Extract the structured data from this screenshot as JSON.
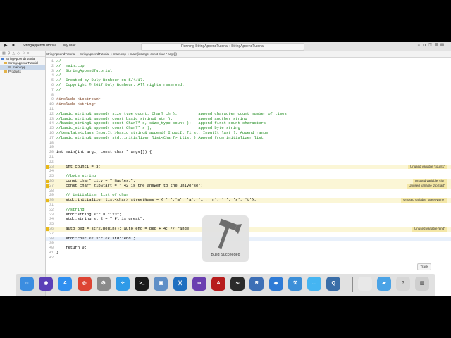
{
  "toolbar": {
    "scheme_app": "StringAppendTutorial",
    "scheme_device": "My Mac",
    "status": "Running StringAppendTutorial : StringAppendTutorial"
  },
  "jumpbar": {
    "items": [
      "StringAppendTutorial",
      "StringAppendTutorial",
      "main.cpp",
      "main(int argc, const char * argv[])"
    ]
  },
  "navigator": {
    "items": [
      {
        "label": "StringAppendTutorial",
        "color": "#4a7fd4"
      },
      {
        "label": "StringAppendTutorial",
        "color": "#e3b34a"
      },
      {
        "label": "main.cpp",
        "color": "#9aa0a6"
      },
      {
        "label": "Products",
        "color": "#e3b34a"
      }
    ]
  },
  "editor": {
    "lines": [
      {
        "n": "1",
        "text": "//",
        "cls": "c-com"
      },
      {
        "n": "2",
        "text": "//  main.cpp",
        "cls": "c-com"
      },
      {
        "n": "3",
        "text": "//  StringAppendTutorial",
        "cls": "c-com"
      },
      {
        "n": "4",
        "text": "//",
        "cls": "c-com"
      },
      {
        "n": "5",
        "text": "//  Created by Duly Bonheur on 5/4/17.",
        "cls": "c-com"
      },
      {
        "n": "6",
        "text": "//  Copyright © 2017 Duly Bonheur. All rights reserved.",
        "cls": "c-com"
      },
      {
        "n": "7",
        "text": "//",
        "cls": "c-com"
      },
      {
        "n": "8",
        "text": "",
        "cls": ""
      },
      {
        "n": "9",
        "text": "#include <iostream>",
        "cls": "c-pre"
      },
      {
        "n": "10",
        "text": "#include <string>",
        "cls": "c-pre"
      },
      {
        "n": "11",
        "text": "",
        "cls": ""
      },
      {
        "n": "12",
        "text": "//basic_string& append( size_type count, CharT ch );         append character count number of times",
        "cls": "c-com"
      },
      {
        "n": "13",
        "text": "//basic_string& append( const basic_string& str );           append another string",
        "cls": "c-com"
      },
      {
        "n": "14",
        "text": "//basic_string& append( const CharT* s, size_type count );   append first count characters",
        "cls": "c-com"
      },
      {
        "n": "15",
        "text": "//basic_string& append( const CharT* s );                    append byte string",
        "cls": "c-com"
      },
      {
        "n": "16",
        "text": "//template<class InputIt >basic_string& append( InputIt first, InputIt last ); Append range",
        "cls": "c-com"
      },
      {
        "n": "17",
        "text": "//basic_string& append( std::initializer_list<CharT> ilist );Append from initializer list",
        "cls": "c-com"
      },
      {
        "n": "18",
        "text": "",
        "cls": ""
      },
      {
        "n": "19",
        "text": "",
        "cls": ""
      },
      {
        "n": "20",
        "text": "int main(int argc, const char * argv[]) {",
        "cls": ""
      },
      {
        "n": "21",
        "text": "",
        "cls": ""
      },
      {
        "n": "22",
        "text": "",
        "cls": ""
      },
      {
        "n": "23",
        "text": "    int count1 = 3;",
        "cls": "",
        "warn": "Unused variable 'count1'"
      },
      {
        "n": "24",
        "text": "",
        "cls": ""
      },
      {
        "n": "25",
        "text": "    //byte string",
        "cls": "c-com"
      },
      {
        "n": "26",
        "text": "    const char* city = \" Naples,\";",
        "cls": "",
        "warn": "Unused variable 'city'"
      },
      {
        "n": "27",
        "text": "    const char* zipStart = \" 42 is the answer to the universe\";",
        "cls": "",
        "warn": "Unused variable 'zipStart'"
      },
      {
        "n": "28",
        "text": "",
        "cls": ""
      },
      {
        "n": "29",
        "text": "    // initializer list of char",
        "cls": "c-com"
      },
      {
        "n": "30",
        "text": "    std::initializer_list<char> streetName = { ' ','m', 'a', 'i', 'n', ' ', 's', 't'};",
        "cls": "",
        "warn": "Unused variable 'streetName'"
      },
      {
        "n": "31",
        "text": "",
        "cls": ""
      },
      {
        "n": "32",
        "text": "    //string",
        "cls": "c-com"
      },
      {
        "n": "33",
        "text": "    std::string str = \"123\";",
        "cls": ""
      },
      {
        "n": "34",
        "text": "    std::string str2 = \" Fl is great\";",
        "cls": ""
      },
      {
        "n": "35",
        "text": "",
        "cls": ""
      },
      {
        "n": "36",
        "text": "    auto beg = str2.begin(); auto end = beg + 4; // range",
        "cls": "",
        "warn": "Unused variable 'end'"
      },
      {
        "n": "37",
        "text": "",
        "cls": ""
      },
      {
        "n": "38",
        "text": "    std::cout << str << std::endl;",
        "cls": "",
        "cur": true
      },
      {
        "n": "39",
        "text": "",
        "cls": ""
      },
      {
        "n": "40",
        "text": "    return 0;",
        "cls": ""
      },
      {
        "n": "41",
        "text": "}",
        "cls": ""
      },
      {
        "n": "42",
        "text": "",
        "cls": ""
      }
    ]
  },
  "hud": {
    "label": "Build Succeeded",
    "icon": "hammer-icon"
  },
  "track_button": "Track",
  "dock": {
    "apps": [
      {
        "name": "finder",
        "color": "#3b8de0",
        "glyph": "☺"
      },
      {
        "name": "siri",
        "color": "#5b3fb8",
        "glyph": "◉"
      },
      {
        "name": "app-store",
        "color": "#2f8ff0",
        "glyph": "A"
      },
      {
        "name": "chrome",
        "color": "#dd4433",
        "glyph": "◎"
      },
      {
        "name": "system-preferences",
        "color": "#8a8a8a",
        "glyph": "⚙"
      },
      {
        "name": "safari",
        "color": "#2e9ae8",
        "glyph": "✧"
      },
      {
        "name": "terminal",
        "color": "#1b1b1b",
        "glyph": ">_"
      },
      {
        "name": "preview",
        "color": "#5f8fc7",
        "glyph": "▣"
      },
      {
        "name": "visual-studio-code",
        "color": "#1f6fc0",
        "glyph": "⟩⟨"
      },
      {
        "name": "visual-studio",
        "color": "#6a3fb0",
        "glyph": "∞"
      },
      {
        "name": "acrobat",
        "color": "#b71c1c",
        "glyph": "A"
      },
      {
        "name": "activity-monitor",
        "color": "#2b2b2b",
        "glyph": "∿"
      },
      {
        "name": "r",
        "color": "#3d6fb6",
        "glyph": "R"
      },
      {
        "name": "keynote",
        "color": "#2f7bd6",
        "glyph": "◆"
      },
      {
        "name": "xcode",
        "color": "#3c8fd8",
        "glyph": "⚒"
      },
      {
        "name": "messages",
        "color": "#45b5f2",
        "glyph": "…"
      },
      {
        "name": "quicktime",
        "color": "#3a6ea8",
        "glyph": "Q"
      },
      {
        "name": "document",
        "color": "#e8e8e8",
        "glyph": ""
      },
      {
        "name": "downloads-folder",
        "color": "#4aa3e6",
        "glyph": "▰"
      },
      {
        "name": "help",
        "color": "#d6d6d6",
        "glyph": "?"
      },
      {
        "name": "trash",
        "color": "#cfcfcf",
        "glyph": "▥"
      }
    ]
  }
}
